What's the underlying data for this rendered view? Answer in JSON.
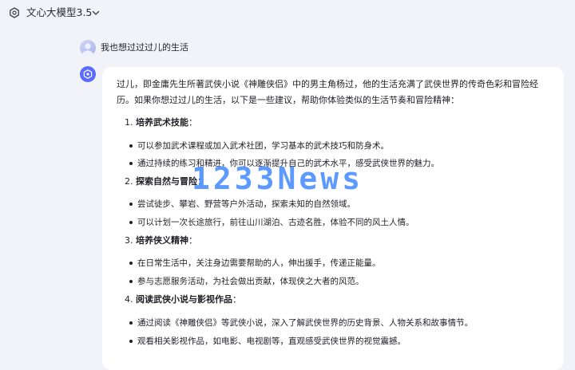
{
  "header": {
    "model_name": "文心大模型3.5",
    "model_icon": "ernie-logo-icon",
    "dropdown_icon": "chevron-down-icon"
  },
  "user_message": {
    "text": "我也想过过过儿的生活"
  },
  "answer": {
    "intro": "过儿，即金庸先生所著武侠小说《神雕侠侣》中的男主角杨过，他的生活充满了武侠世界的传奇色彩和冒险经历。如果你想过过儿的生活，以下是一些建议，帮助你体验类似的生活节奏和冒险精神：",
    "sections": [
      {
        "number": "1.",
        "title": "培养武术技能",
        "suffix": "：",
        "bullets": [
          "可以参加武术课程或加入武术社团，学习基本的武术技巧和防身术。",
          "通过持续的练习和精进，你可以逐渐提升自己的武术水平，感受武侠世界的魅力。"
        ]
      },
      {
        "number": "2.",
        "title": "探索自然与冒险",
        "suffix": "：",
        "bullets": [
          "尝试徒步、攀岩、野营等户外活动，探索未知的自然领域。",
          "可以计划一次长途旅行，前往山川湖泊、古迹名胜，体验不同的风土人情。"
        ]
      },
      {
        "number": "3.",
        "title": "培养侠义精神",
        "suffix": "：",
        "bullets": [
          "在日常生活中，关注身边需要帮助的人，伸出援手，传递正能量。",
          "参与志愿服务活动，为社会做出贡献，体现侠之大者的风范。"
        ]
      },
      {
        "number": "4.",
        "title": "阅读武侠小说与影视作品",
        "suffix": "：",
        "bullets": [
          "通过阅读《神雕侠侣》等武侠小说，深入了解武侠世界的历史背景、人物关系和故事情节。",
          "观看相关影视作品，如电影、电视剧等，直观感受武侠世界的视觉震撼。"
        ]
      }
    ]
  },
  "watermark": {
    "text": "1233News"
  },
  "colors": {
    "page_bg": "#f2f3f8",
    "card_bg": "#ffffff",
    "text": "#1f1f26",
    "bot_avatar": "#5b6bff",
    "watermark": "#3884ff"
  }
}
